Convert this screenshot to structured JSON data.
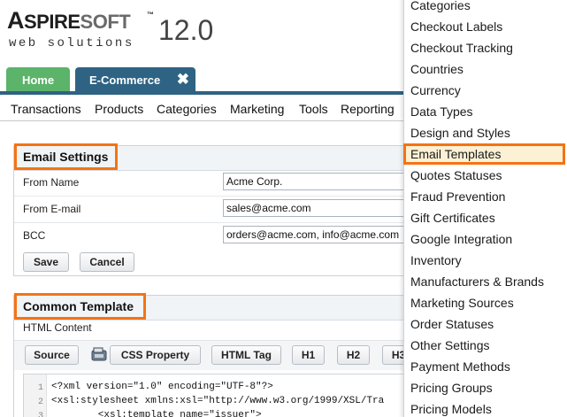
{
  "logo": {
    "brand_a": "A",
    "brand_b": "SPIRE",
    "brand_c": "SOFT",
    "tm": "™",
    "version": "12.0",
    "tagline": "web solutions"
  },
  "tabs": {
    "home": "Home",
    "ecommerce": "E-Commerce",
    "close_icon": "✖"
  },
  "submenu": [
    "Transactions",
    "Products",
    "Categories",
    "Marketing",
    "Tools",
    "Reporting"
  ],
  "email_settings": {
    "title": "Email Settings",
    "from_name_label": "From Name",
    "from_name_value": "Acme Corp.",
    "from_email_label": "From E-mail",
    "from_email_value": "sales@acme.com",
    "bcc_label": "BCC",
    "bcc_value": "orders@acme.com, info@acme.com",
    "save": "Save",
    "cancel": "Cancel"
  },
  "common_template": {
    "title": "Common Template",
    "html_content_label": "HTML Content",
    "toolbar": {
      "source": "Source",
      "css_property": "CSS Property",
      "html_tag": "HTML Tag",
      "h1": "H1",
      "h2": "H2",
      "h3": "H3"
    },
    "code_lines": [
      {
        "n": "1",
        "text": "<?xml version=\"1.0\" encoding=\"UTF-8\"?>"
      },
      {
        "n": "2",
        "text": "<xsl:stylesheet xmlns:xsl=\"http://www.w3.org/1999/XSL/Tra"
      },
      {
        "n": "3",
        "text": "        <xsl:template name=\"issuer\">"
      }
    ]
  },
  "dropdown": {
    "items": [
      "Categories",
      "Checkout Labels",
      "Checkout Tracking",
      "Countries",
      "Currency",
      "Data Types",
      "Design and Styles",
      "Email Templates",
      "Quotes Statuses",
      "Fraud Prevention",
      "Gift Certificates",
      "Google Integration",
      "Inventory",
      "Manufacturers & Brands",
      "Marketing Sources",
      "Order Statuses",
      "Other Settings",
      "Payment Methods",
      "Pricing Groups",
      "Pricing Models"
    ],
    "selected": "Email Templates"
  },
  "colors": {
    "accent_orange": "#f47316",
    "tab_home": "#5cb36a",
    "tab_active": "#2e6383",
    "selected_bg": "#fdf1d5"
  }
}
